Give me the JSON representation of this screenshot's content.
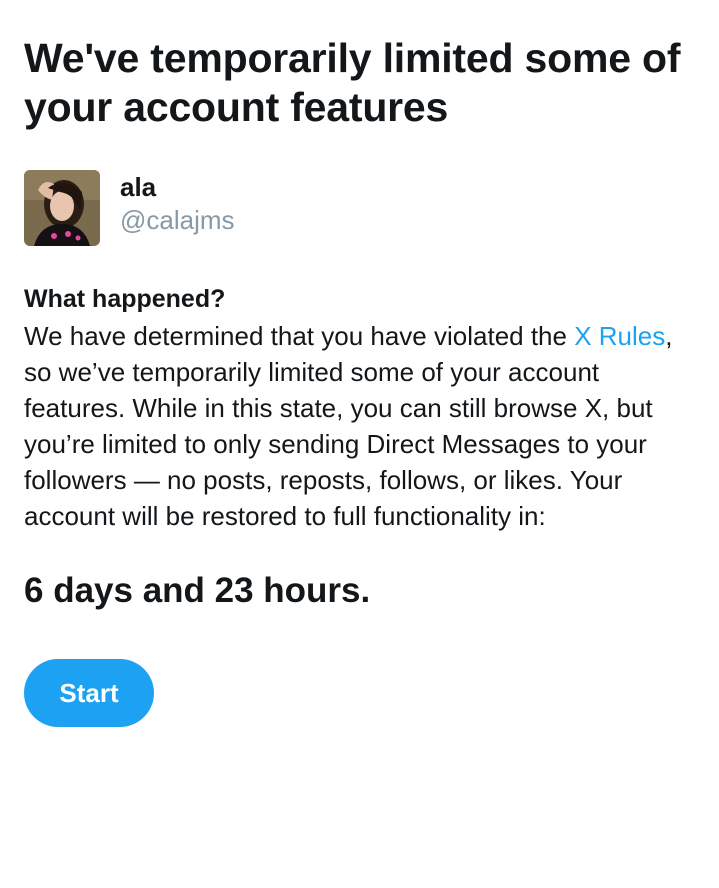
{
  "title": "We've temporarily limited some of your account features",
  "account": {
    "display_name": "ala",
    "handle": "@calajms"
  },
  "notice": {
    "heading": "What happened?",
    "text_before_link": "We have determined that you have violated the ",
    "link_text": "X Rules",
    "text_after_link": ", so we’ve temporarily limited some of your account features. While in this state, you can still browse X, but you’re limited to only sending Direct Messages to your followers — no posts, reposts, follows, or likes. Your account will be restored to full functionality in:"
  },
  "countdown": "6 days and 23 hours.",
  "start_button_label": "Start",
  "colors": {
    "accent": "#1da1f2",
    "text": "#14171a",
    "secondary_text": "#8899a6",
    "background": "#ffffff"
  }
}
